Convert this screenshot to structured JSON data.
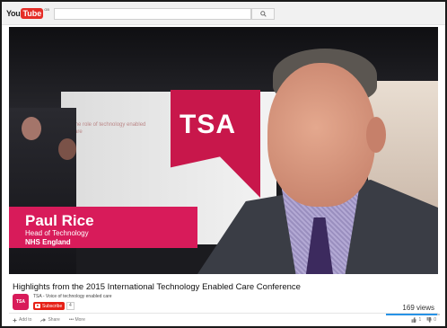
{
  "header": {
    "logo_you": "You",
    "logo_tube": "Tube",
    "logo_suffix": "GB",
    "search_placeholder": ""
  },
  "video": {
    "booth_text": "The role of technology enabled care",
    "booth_logo": "TSA",
    "lower_third": {
      "name": "Paul Rice",
      "role": "Head of Technology",
      "organisation": "NHS England"
    }
  },
  "info": {
    "title": "Highlights from the 2015 International Technology Enabled Care Conference",
    "channel_avatar": "TSA",
    "channel_name": "TSA - Voice of technology enabled care",
    "subscribe_label": "Subscribe",
    "subscriber_count": "4",
    "views": "169 views",
    "like_ratio": 0.95
  },
  "actions": {
    "add_label": "Add to",
    "share_label": "Share",
    "more_label": "••• More",
    "likes": "1",
    "dislikes": "0"
  },
  "colors": {
    "brand_red": "#e52d27",
    "lower_third": "#d81b5a",
    "tsa": "#c8174b",
    "like_bar": "#2793e6"
  }
}
